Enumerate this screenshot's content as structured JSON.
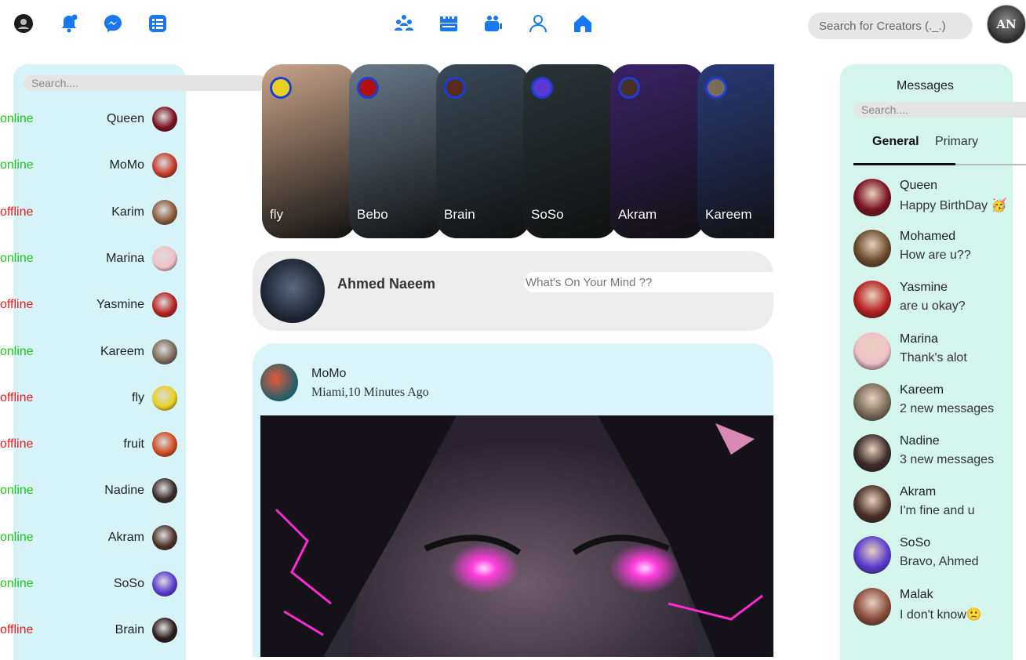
{
  "topbar": {
    "left_icons": [
      "user-icon",
      "notifications-bell-icon",
      "messenger-icon",
      "list-icon"
    ],
    "center_icons": [
      "groups-icon",
      "marketplace-icon",
      "watch-icon",
      "profile-icon",
      "home-icon"
    ],
    "search_placeholder": "Search for Creators (._.)",
    "profile_initials": "AN",
    "accent_color": "#1877f2"
  },
  "friends": {
    "search_placeholder": "Search....",
    "items": [
      {
        "status": "online",
        "name": "Queen",
        "color": "#7a1020"
      },
      {
        "status": "online",
        "name": "MoMo",
        "color": "#c43a2a"
      },
      {
        "status": "offline",
        "name": "Karim",
        "color": "#8a5a3a"
      },
      {
        "status": "online",
        "name": "Marina",
        "color": "#f0c0c8"
      },
      {
        "status": "offline",
        "name": "Yasmine",
        "color": "#b82020"
      },
      {
        "status": "online",
        "name": "Kareem",
        "color": "#7a6a5a"
      },
      {
        "status": "offline",
        "name": "fly",
        "color": "#e8d020"
      },
      {
        "status": "offline",
        "name": "fruit",
        "color": "#d04a20"
      },
      {
        "status": "online",
        "name": "Nadine",
        "color": "#3a2a28"
      },
      {
        "status": "online",
        "name": "Akram",
        "color": "#4a3028"
      },
      {
        "status": "online",
        "name": "SoSo",
        "color": "#5a3ad0"
      },
      {
        "status": "offline",
        "name": "Brain",
        "color": "#2a1a1a"
      }
    ]
  },
  "stories": [
    {
      "name": "fly",
      "bg": "#c9a48a",
      "av": "#e8d020"
    },
    {
      "name": "Bebo",
      "bg": "#6a7a8a",
      "av": "#b01010"
    },
    {
      "name": "Brain",
      "bg": "#3a4a58",
      "av": "#5a2a20"
    },
    {
      "name": "SoSo",
      "bg": "#2a3438",
      "av": "#5a3ad0"
    },
    {
      "name": "Akram",
      "bg": "#3a2268",
      "av": "#4a3028"
    },
    {
      "name": "Kareem",
      "bg": "#2a3a78",
      "av": "#7a6a5a"
    }
  ],
  "composer": {
    "user_name": "Ahmed Naeem",
    "placeholder": "What's On Your Mind ??"
  },
  "post": {
    "author": "MoMo",
    "location_time": "Miami,10 Minutes Ago"
  },
  "messages": {
    "title": "Messages",
    "search_placeholder": "Search....",
    "tabs": [
      "General",
      "Primary"
    ],
    "items": [
      {
        "name": "Queen",
        "text": "Happy BirthDay 🥳",
        "color": "#7a1020"
      },
      {
        "name": "Mohamed",
        "text": "How are u??",
        "color": "#6a4a2a"
      },
      {
        "name": "Yasmine",
        "text": "are u okay?",
        "color": "#b82020"
      },
      {
        "name": "Marina",
        "text": "Thank's alot",
        "color": "#f0c0c8"
      },
      {
        "name": "Kareem",
        "text": "2 new messages",
        "color": "#7a6a5a"
      },
      {
        "name": "Nadine",
        "text": "3 new messages",
        "color": "#3a2a28"
      },
      {
        "name": "Akram",
        "text": "I'm fine and u",
        "color": "#4a3028"
      },
      {
        "name": "SoSo",
        "text": "Bravo, Ahmed",
        "color": "#5a3ad0"
      },
      {
        "name": "Malak",
        "text": "I don't know🙁",
        "color": "#8a4a3a"
      }
    ]
  }
}
